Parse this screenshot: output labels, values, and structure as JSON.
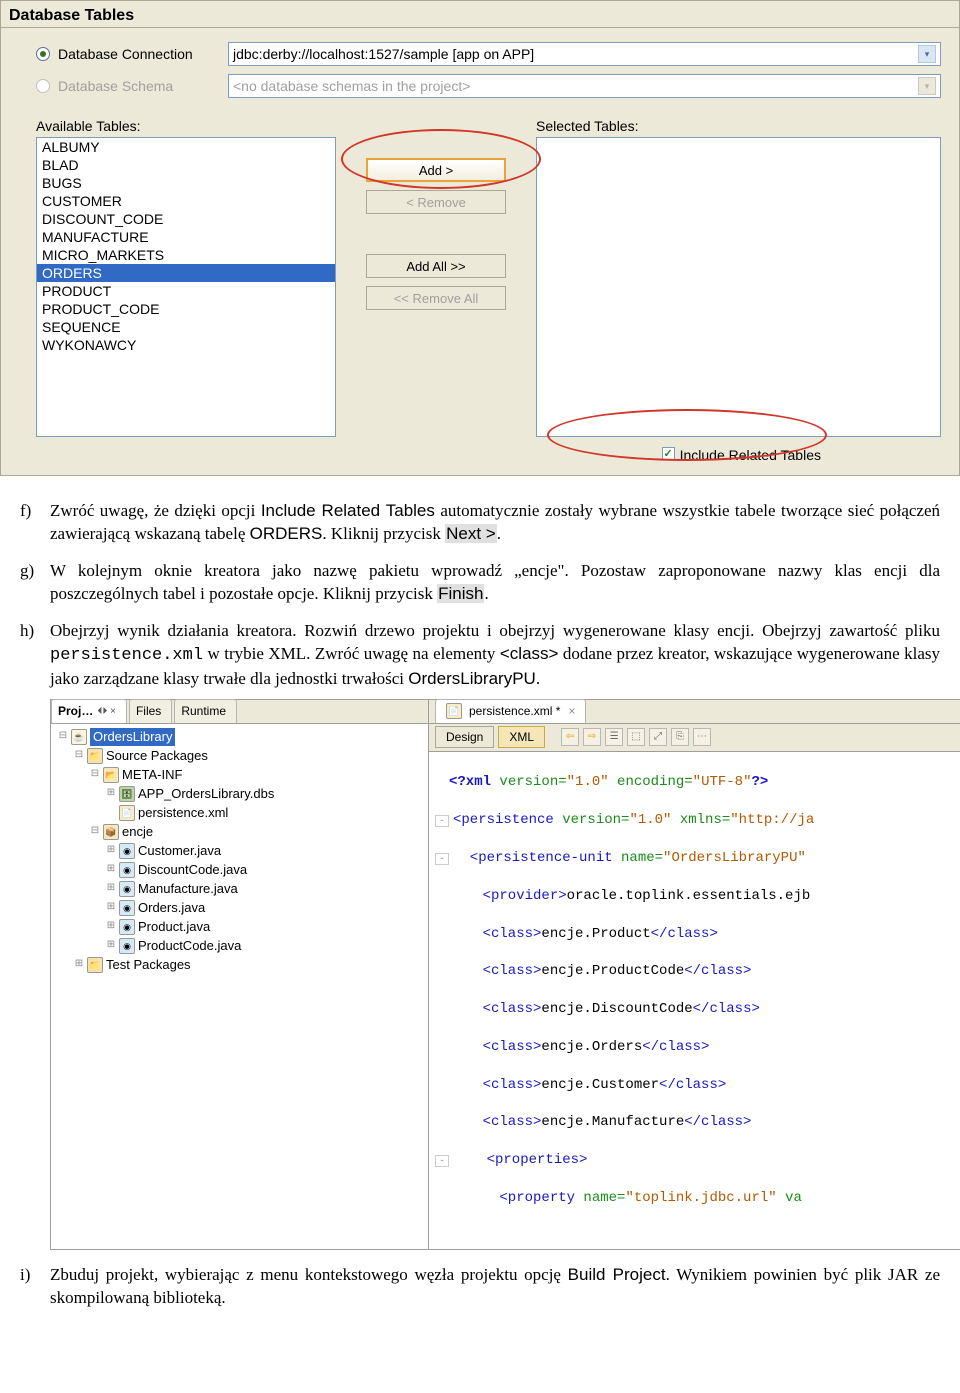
{
  "wizard": {
    "title": "Database Tables",
    "conn_label": "Database Connection",
    "conn_value": "jdbc:derby://localhost:1527/sample [app on APP]",
    "schema_label": "Database Schema",
    "schema_placeholder": "<no database schemas in the project>",
    "available_label": "Available Tables:",
    "selected_label": "Selected Tables:",
    "tables": [
      "ALBUMY",
      "BLAD",
      "BUGS",
      "CUSTOMER",
      "DISCOUNT_CODE",
      "MANUFACTURE",
      "MICRO_MARKETS",
      "ORDERS",
      "PRODUCT",
      "PRODUCT_CODE",
      "SEQUENCE",
      "WYKONAWCY"
    ],
    "selected_table": "ORDERS",
    "btn_add": "Add >",
    "btn_remove": "< Remove",
    "btn_addall": "Add All >>",
    "btn_removeall": "<< Remove All",
    "include_label": "Include Related Tables"
  },
  "doc": {
    "f_marker": "f)",
    "f_p1": "Zwróć uwagę, że dzięki opcji ",
    "f_sans1": "Include Related Tables",
    "f_p2": " automatycznie zostały wybrane wszystkie tabele tworzące sieć połączeń zawierającą wskazaną tabelę ",
    "f_sans2": "ORDERS",
    "f_p3": ". Kliknij przycisk ",
    "f_hl1": "Next >",
    "f_p4": ".",
    "g_marker": "g)",
    "g_p1": "W kolejnym oknie kreatora jako nazwę pakietu wprowadź „encje\". Pozostaw zaproponowane nazwy klas encji dla poszczególnych tabel i pozostałe opcje. Kliknij przycisk ",
    "g_hl1": "Finish",
    "g_p2": ".",
    "h_marker": "h)",
    "h_p1": "Obejrzyj wynik działania kreatora. Rozwiń drzewo projektu i obejrzyj wygenerowane klasy encji. Obejrzyj zawartość pliku ",
    "h_mono1": "persistence.xml",
    "h_p2": " w trybie XML. Zwróć uwagę na elementy ",
    "h_sans1": "<class>",
    "h_p3": " dodane przez kreator, wskazujące wygenerowane klasy jako zarządzane klasy trwałe dla jednostki trwałości ",
    "h_sans2": "OrdersLibraryPU",
    "h_p4": ".",
    "i_marker": "i)",
    "i_p1": "Zbuduj projekt, wybierając z menu kontekstowego węzła projektu opcję ",
    "i_sans1": "Build Project",
    "i_p2": ". Wynikiem powinien być plik JAR ze skompilowaną biblioteką."
  },
  "ide": {
    "tab_proj": "Proj…",
    "tab_proj_sub": "⏴⏵ ×",
    "tab_files": "Files",
    "tab_runtime": "Runtime",
    "tree": {
      "n1": "OrdersLibrary",
      "n2": "Source Packages",
      "n3": "META-INF",
      "n4": "APP_OrdersLibrary.dbs",
      "n5": "persistence.xml",
      "n6": "encje",
      "n7": "Customer.java",
      "n8": "DiscountCode.java",
      "n9": "Manufacture.java",
      "n10": "Orders.java",
      "n11": "Product.java",
      "n12": "ProductCode.java",
      "n13": "Test Packages"
    },
    "editor_tab": "persistence.xml *",
    "toggle_design": "Design",
    "toggle_xml": "XML",
    "xml": {
      "l1_a": "<?xml",
      "l1_b": " version=",
      "l1_c": "\"1.0\"",
      "l1_d": " encoding=",
      "l1_e": "\"UTF-8\"",
      "l1_f": "?>",
      "l2_a": "<persistence ",
      "l2_b": "version=",
      "l2_c": "\"1.0\"",
      "l2_d": " xmlns=",
      "l2_e": "\"http://ja",
      "l3_a": "  <persistence-unit ",
      "l3_b": "name=",
      "l3_c": "\"OrdersLibraryPU\"",
      "l4_a": "    <provider>",
      "l4_b": "oracle.toplink.essentials.ejb",
      "l5_a": "    <class>",
      "l5_b": "encje.Product",
      "l5_c": "</class>",
      "l6_a": "    <class>",
      "l6_b": "encje.ProductCode",
      "l6_c": "</class>",
      "l7_a": "    <class>",
      "l7_b": "encje.DiscountCode",
      "l7_c": "</class>",
      "l8_a": "    <class>",
      "l8_b": "encje.Orders",
      "l8_c": "</class>",
      "l9_a": "    <class>",
      "l9_b": "encje.Customer",
      "l9_c": "</class>",
      "l10_a": "    <class>",
      "l10_b": "encje.Manufacture",
      "l10_c": "</class>",
      "l11_a": "    <properties>",
      "l12_a": "      <property ",
      "l12_b": "name=",
      "l12_c": "\"toplink.jdbc.url\"",
      "l12_d": " va"
    }
  }
}
